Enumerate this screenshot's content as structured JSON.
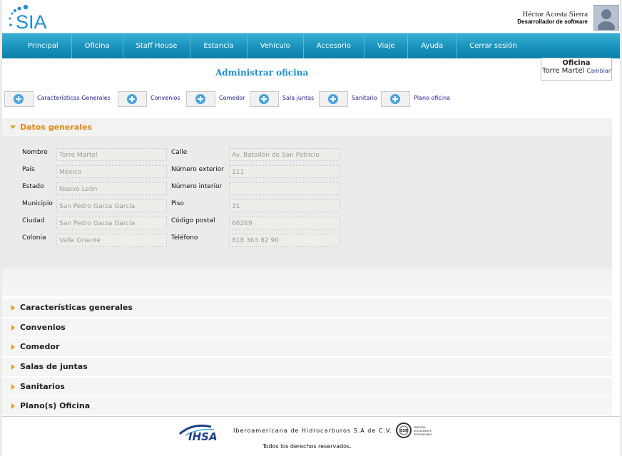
{
  "header": {
    "logo_text": "SIA",
    "user_name": "Héctor Acosta Sierra",
    "user_role": "Desarrollador de software"
  },
  "nav": {
    "items": [
      "Principal",
      "Oficina",
      "Staff House",
      "Estancia",
      "Vehículo",
      "Accesorio",
      "Viaje",
      "Ayuda",
      "Cerrar sesión"
    ]
  },
  "page_title": "Administrar oficina",
  "office_box": {
    "heading": "Oficina",
    "value": "Torre Martel",
    "change_link": "Cambiar"
  },
  "tabs": [
    "Características Generales",
    "Convenios",
    "Comedor",
    "Sala juntas",
    "Sanitario",
    "Plano oficina"
  ],
  "datos_generales": {
    "title": "Datos generales",
    "fields_left": [
      {
        "label": "Nombre",
        "value": "Torre Martel"
      },
      {
        "label": "País",
        "value": "México"
      },
      {
        "label": "Estado",
        "value": "Nuevo León"
      },
      {
        "label": "Municipio",
        "value": "San Pedro Garza García"
      },
      {
        "label": "Ciudad",
        "value": "San Pedro Garza García"
      },
      {
        "label": "Colonia",
        "value": "Valle Oriente"
      }
    ],
    "fields_right": [
      {
        "label": "Calle",
        "value": "Av. Batallón de San Patricio"
      },
      {
        "label": "Número exterior",
        "value": "111"
      },
      {
        "label": "Número interior",
        "value": ""
      },
      {
        "label": "Piso",
        "value": "31"
      },
      {
        "label": "Código postal",
        "value": "66269"
      },
      {
        "label": "Teléfono",
        "value": " 818 363 82 90"
      }
    ]
  },
  "sections": [
    "Características generales",
    "Convenios",
    "Comedor",
    "Salas de juntas",
    "Sanitarios",
    "Plano(s) Oficina"
  ],
  "footer": {
    "ihsa_logo_text": "IHSA",
    "company": "Iberoamericana de Hidrocarburos S.A de C.V.",
    "esr_text": "ESR",
    "esr_caption": "EMPRESA SOCIALMENTE RESPONSABLE",
    "rights": "Todos los derechos reservados."
  },
  "colors": {
    "nav_bar": "#168fba",
    "title_blue": "#1b8fd1",
    "accent_orange": "#e08a12"
  }
}
